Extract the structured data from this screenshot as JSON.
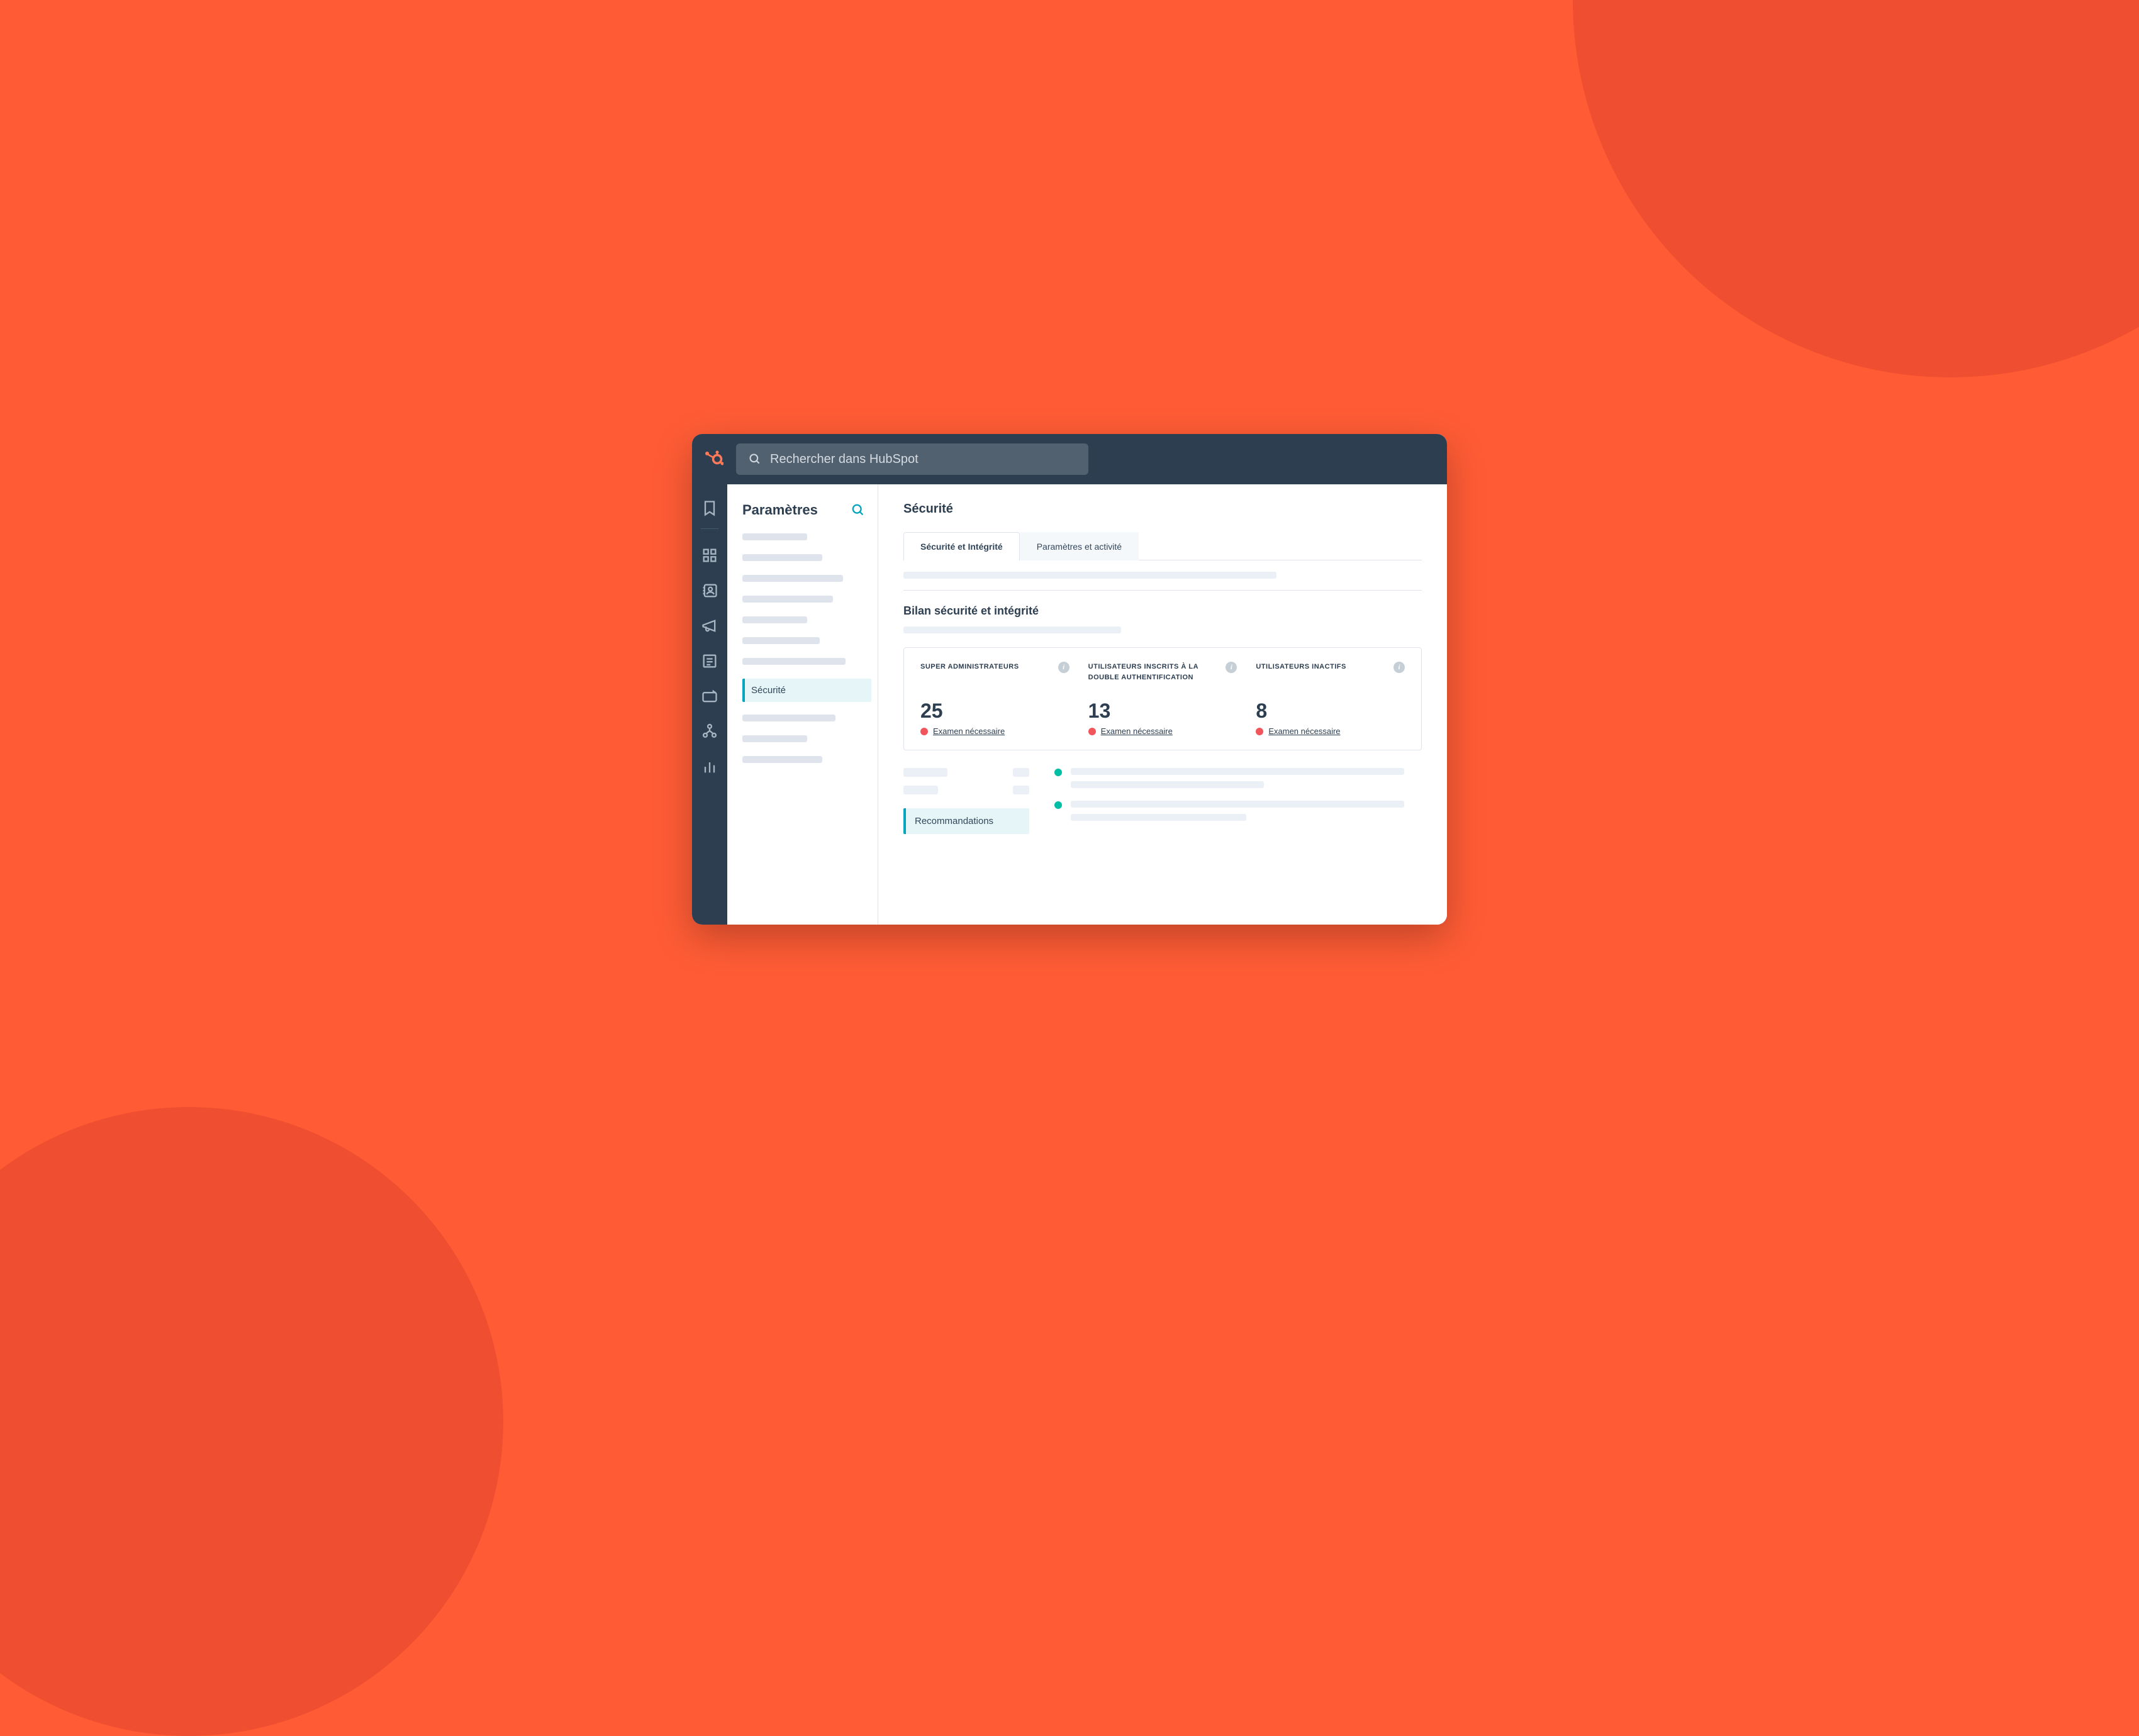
{
  "search": {
    "placeholder": "Rechercher dans HubSpot"
  },
  "sidebar": {
    "title": "Paramètres",
    "active_item": "Sécurité"
  },
  "main": {
    "title": "Sécurité",
    "tabs": [
      {
        "label": "Sécurité et Intégrité",
        "active": true
      },
      {
        "label": "Paramètres et activité",
        "active": false
      }
    ],
    "subsection_title": "Bilan sécurité et intégrité",
    "stats": [
      {
        "label": "SUPER ADMINISTRATEURS",
        "value": "25",
        "status": "Examen nécessaire",
        "status_color": "red"
      },
      {
        "label": "UTILISATEURS INSCRITS À LA DOUBLE AUTHENTIFICATION",
        "value": "13",
        "status": "Examen nécessaire",
        "status_color": "red"
      },
      {
        "label": "UTILISATEURS INACTIFS",
        "value": "8",
        "status": "Examen nécessaire",
        "status_color": "red"
      }
    ],
    "recommendations_label": "Recommandations"
  },
  "colors": {
    "accent": "#FF7A59",
    "teal": "#00A4BD",
    "navy": "#2D3E50",
    "red": "#F2545B"
  }
}
